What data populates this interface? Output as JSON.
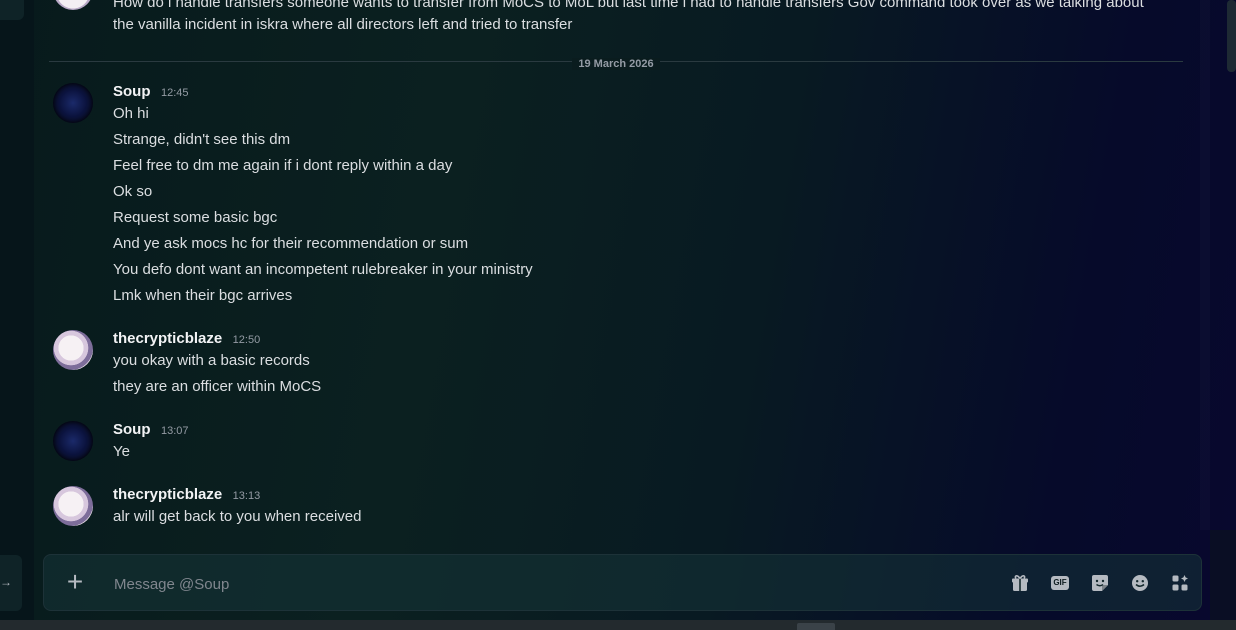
{
  "top_message": {
    "text": "How do i handle transfers someone wants to transfer from MoCS to MoL but last time i had to handle transfers Gov command took over as we talking about the vanilla incident in iskra where all directors left and tried to transfer"
  },
  "date_divider": "19 March 2026",
  "groups": [
    {
      "author": "Soup",
      "time": "12:45",
      "avatar": "soup-avatar",
      "lines": [
        "Oh hi",
        "Strange, didn't see this dm",
        "Feel free to dm me again if i dont reply within a day",
        "Ok so",
        "Request some basic bgc",
        "And ye ask mocs hc for their recommendation or sum",
        "You defo dont want an incompetent rulebreaker in your ministry",
        "Lmk when their bgc arrives"
      ]
    },
    {
      "author": "thecrypticblaze",
      "time": "12:50",
      "avatar": "thecrypticblaze-avatar",
      "lines": [
        "you okay with a basic records",
        "they are an officer within MoCS"
      ]
    },
    {
      "author": "Soup",
      "time": "13:07",
      "avatar": "soup-avatar",
      "lines": [
        "Ye"
      ]
    },
    {
      "author": "thecrypticblaze",
      "time": "13:13",
      "avatar": "thecrypticblaze-avatar",
      "lines": [
        "alr will get back to you when received"
      ]
    }
  ],
  "composer": {
    "placeholder": "Message @Soup",
    "add_icon": "plus-icon",
    "gif_label": "GIF",
    "tools": [
      "gift-icon",
      "gif-icon",
      "sticker-icon",
      "emoji-icon",
      "apps-icon"
    ]
  },
  "left_rail": {
    "glyph": "→"
  }
}
